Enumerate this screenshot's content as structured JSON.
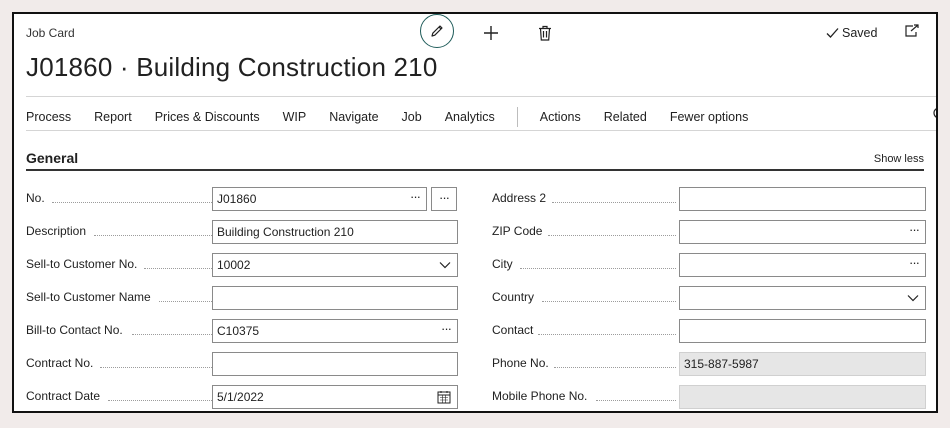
{
  "page": {
    "kind": "Job Card",
    "title": "J01860 · Building Construction 210",
    "status": "Saved"
  },
  "icons": {
    "edit": "pencil-icon",
    "new": "plus-icon",
    "delete": "trash-icon",
    "saved": "check-icon",
    "open_new": "open-in-new-window-icon",
    "search": "search-icon"
  },
  "actions": [
    "Process",
    "Report",
    "Prices & Discounts",
    "WIP",
    "Navigate",
    "Job",
    "Analytics"
  ],
  "actions_secondary": [
    "Actions",
    "Related",
    "Fewer options"
  ],
  "section": {
    "title": "General",
    "toggle": "Show less"
  },
  "left_fields": [
    {
      "label": "No.",
      "value": "J01860",
      "control": "assist-edit"
    },
    {
      "label": "Description",
      "value": "Building Construction 210",
      "control": "text"
    },
    {
      "label": "Sell-to Customer No.",
      "value": "10002",
      "control": "dropdown"
    },
    {
      "label": "Sell-to Customer Name",
      "value": "",
      "control": "text"
    },
    {
      "label": "Bill-to Contact No.",
      "value": "C10375",
      "control": "lookup"
    },
    {
      "label": "Contract No.",
      "value": "",
      "control": "text"
    },
    {
      "label": "Contract Date",
      "value": "5/1/2022",
      "control": "date"
    }
  ],
  "right_fields": [
    {
      "label": "Address 2",
      "value": "",
      "control": "text"
    },
    {
      "label": "ZIP Code",
      "value": "",
      "control": "lookup"
    },
    {
      "label": "City",
      "value": "",
      "control": "lookup"
    },
    {
      "label": "Country",
      "value": "",
      "control": "dropdown"
    },
    {
      "label": "Contact",
      "value": "",
      "control": "text"
    },
    {
      "label": "Phone No.",
      "value": "315-887-5987",
      "control": "readonly"
    },
    {
      "label": "Mobile Phone No.",
      "value": "",
      "control": "readonly"
    }
  ],
  "colors": {
    "accent": "#1f5c5a",
    "frame_bg": "#f1ebea",
    "readonly_bg": "#e6e6e6"
  }
}
